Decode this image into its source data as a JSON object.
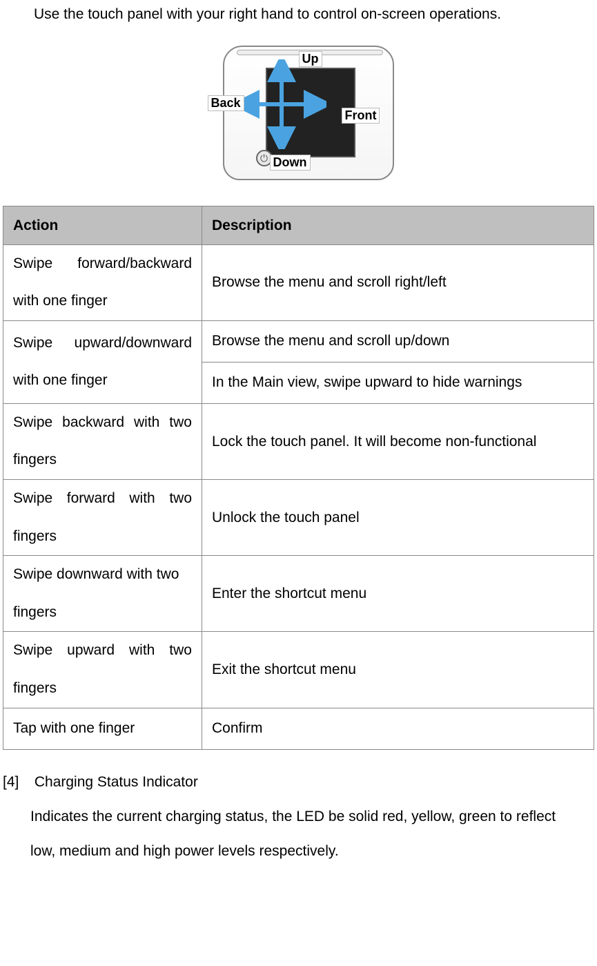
{
  "intro": "Use the touch panel with your right hand to control on-screen operations.",
  "diagram": {
    "labels": {
      "up": "Up",
      "down": "Down",
      "back": "Back",
      "front": "Front"
    }
  },
  "table": {
    "headers": {
      "action": "Action",
      "description": "Description"
    },
    "rows": [
      {
        "action_l1": "Swipe forward/backward",
        "action_l2": "with one finger",
        "desc": "Browse the menu and scroll right/left"
      },
      {
        "action_l1": "Swipe upward/downward",
        "action_l2": "with one finger",
        "desc1": "Browse the menu and scroll up/down",
        "desc2": "In the Main view, swipe upward to hide warnings"
      },
      {
        "action_l1": "Swipe backward with two",
        "action_l2": "fingers",
        "desc": "Lock the touch panel. It will become non-functional"
      },
      {
        "action_l1": "Swipe forward with two",
        "action_l2": "fingers",
        "desc": "Unlock the touch panel"
      },
      {
        "action_l1": "Swipe downward with two",
        "action_l2": "fingers",
        "desc": "Enter the shortcut menu"
      },
      {
        "action_l1": "Swipe upward with two",
        "action_l2": "fingers",
        "desc": "Exit the shortcut menu"
      },
      {
        "action_single": "Tap with one finger",
        "desc": "Confirm"
      }
    ]
  },
  "section4": {
    "num": "[4]",
    "title": "Charging Status Indicator",
    "body": "Indicates the current charging status, the LED be solid red, yellow, green to reflect low, medium and high power levels respectively."
  }
}
